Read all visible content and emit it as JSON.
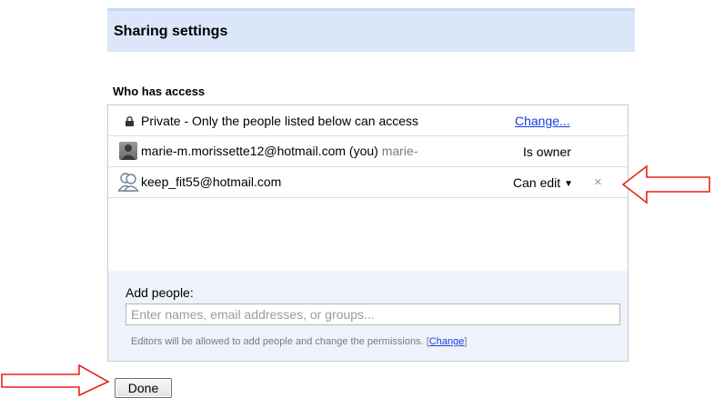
{
  "dialog": {
    "title": "Sharing settings",
    "who_has_access_label": "Who has access"
  },
  "access": {
    "visibility_text": "Private - Only the people listed below can access",
    "change_link": "Change..."
  },
  "members": [
    {
      "email": "marie-m.morissette12@hotmail.com (you)",
      "name_suffix": "marie-",
      "role": "Is owner",
      "icon": "user-avatar"
    },
    {
      "email": "keep_fit55@hotmail.com",
      "permission": "Can edit",
      "remove_symbol": "×",
      "icon": "person-outline-icon"
    }
  ],
  "add_people": {
    "label": "Add people:",
    "placeholder": "Enter names, email addresses, or groups...",
    "value": "",
    "editors_note": "Editors will be allowed to add people and change the permissions.",
    "editors_note_bracket_open": "[",
    "editors_note_link": "Change",
    "editors_note_bracket_close": "]"
  },
  "actions": {
    "done_label": "Done"
  },
  "annotations": {
    "arrow_color": "#e8231b"
  }
}
